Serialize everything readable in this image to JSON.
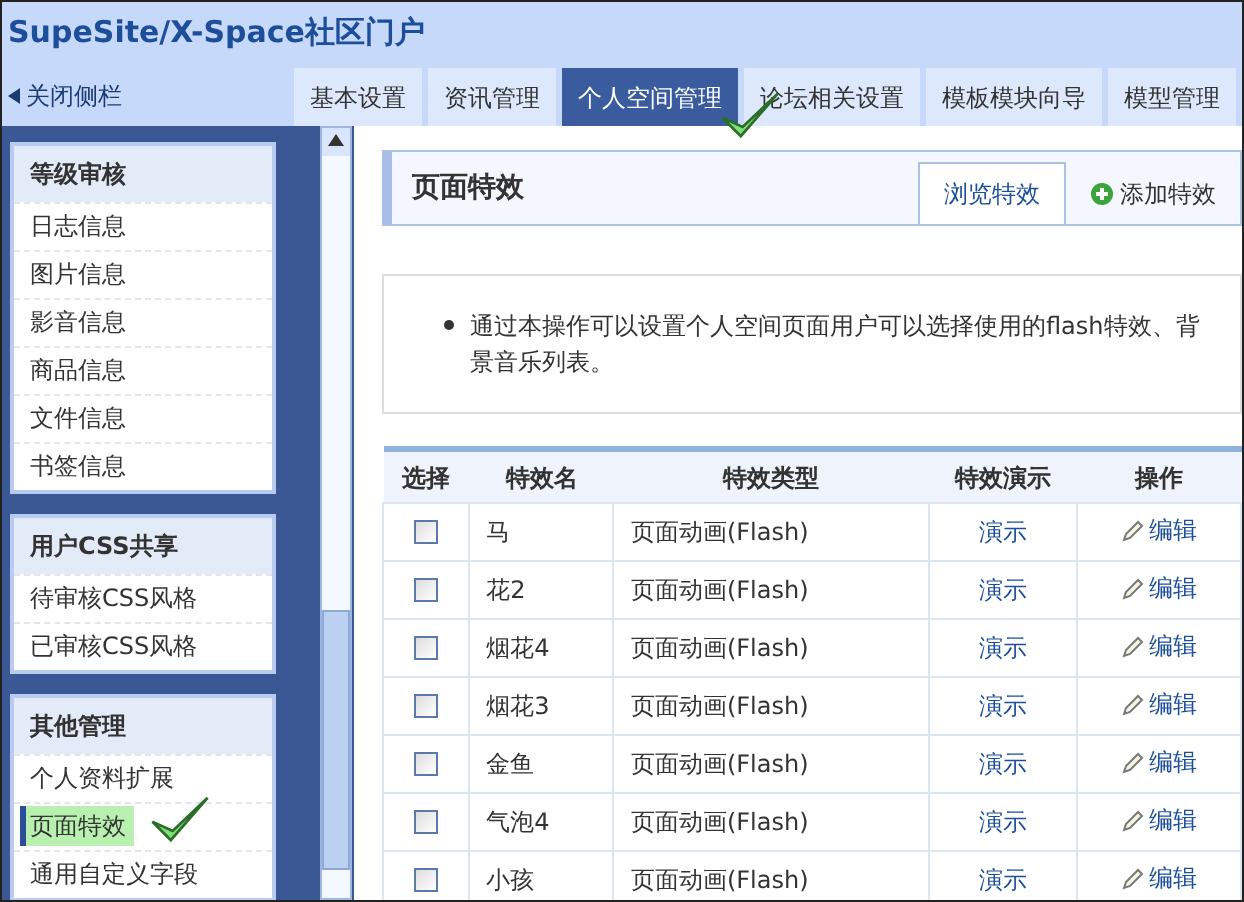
{
  "window": {
    "title": "SupeSite/X-Space社区门户"
  },
  "sidebar_toggle": {
    "label": "关闭侧栏"
  },
  "tabs": [
    {
      "label": "基本设置",
      "selected": false,
      "check_mark": false
    },
    {
      "label": "资讯管理",
      "selected": false,
      "check_mark": false
    },
    {
      "label": "个人空间管理",
      "selected": true,
      "check_mark": true
    },
    {
      "label": "论坛相关设置",
      "selected": false,
      "check_mark": false
    },
    {
      "label": "模板模块向导",
      "selected": false,
      "check_mark": false
    },
    {
      "label": "模型管理",
      "selected": false,
      "check_mark": false
    }
  ],
  "sidebar": {
    "groups": [
      {
        "title": "等级审核",
        "items": [
          {
            "label": "日志信息",
            "selected": false,
            "check_mark": false
          },
          {
            "label": "图片信息",
            "selected": false,
            "check_mark": false
          },
          {
            "label": "影音信息",
            "selected": false,
            "check_mark": false
          },
          {
            "label": "商品信息",
            "selected": false,
            "check_mark": false
          },
          {
            "label": "文件信息",
            "selected": false,
            "check_mark": false
          },
          {
            "label": "书签信息",
            "selected": false,
            "check_mark": false
          }
        ]
      },
      {
        "title": "用户CSS共享",
        "items": [
          {
            "label": "待审核CSS风格",
            "selected": false,
            "check_mark": false
          },
          {
            "label": "已审核CSS风格",
            "selected": false,
            "check_mark": false
          }
        ]
      },
      {
        "title": "其他管理",
        "items": [
          {
            "label": "个人资料扩展",
            "selected": false,
            "check_mark": false
          },
          {
            "label": "页面特效",
            "selected": true,
            "check_mark": true
          },
          {
            "label": "通用自定义字段",
            "selected": false,
            "check_mark": false
          }
        ]
      }
    ]
  },
  "panel": {
    "title": "页面特效",
    "tabs": [
      {
        "label": "浏览特效",
        "selected": true,
        "kind": "plain"
      },
      {
        "label": "添加特效",
        "selected": false,
        "kind": "add"
      }
    ]
  },
  "notice": "通过本操作可以设置个人空间页面用户可以选择使用的flash特效、背景音乐列表。",
  "table": {
    "columns": [
      "选择",
      "特效名",
      "特效类型",
      "特效演示",
      "操作"
    ],
    "rows": [
      {
        "checked": false,
        "name": "马",
        "type": "页面动画(Flash)",
        "demo": "演示",
        "action": "编辑"
      },
      {
        "checked": false,
        "name": "花2",
        "type": "页面动画(Flash)",
        "demo": "演示",
        "action": "编辑"
      },
      {
        "checked": false,
        "name": "烟花4",
        "type": "页面动画(Flash)",
        "demo": "演示",
        "action": "编辑"
      },
      {
        "checked": false,
        "name": "烟花3",
        "type": "页面动画(Flash)",
        "demo": "演示",
        "action": "编辑"
      },
      {
        "checked": false,
        "name": "金鱼",
        "type": "页面动画(Flash)",
        "demo": "演示",
        "action": "编辑"
      },
      {
        "checked": false,
        "name": "气泡4",
        "type": "页面动画(Flash)",
        "demo": "演示",
        "action": "编辑"
      },
      {
        "checked": false,
        "name": "小孩",
        "type": "页面动画(Flash)",
        "demo": "演示",
        "action": "编辑"
      }
    ]
  }
}
